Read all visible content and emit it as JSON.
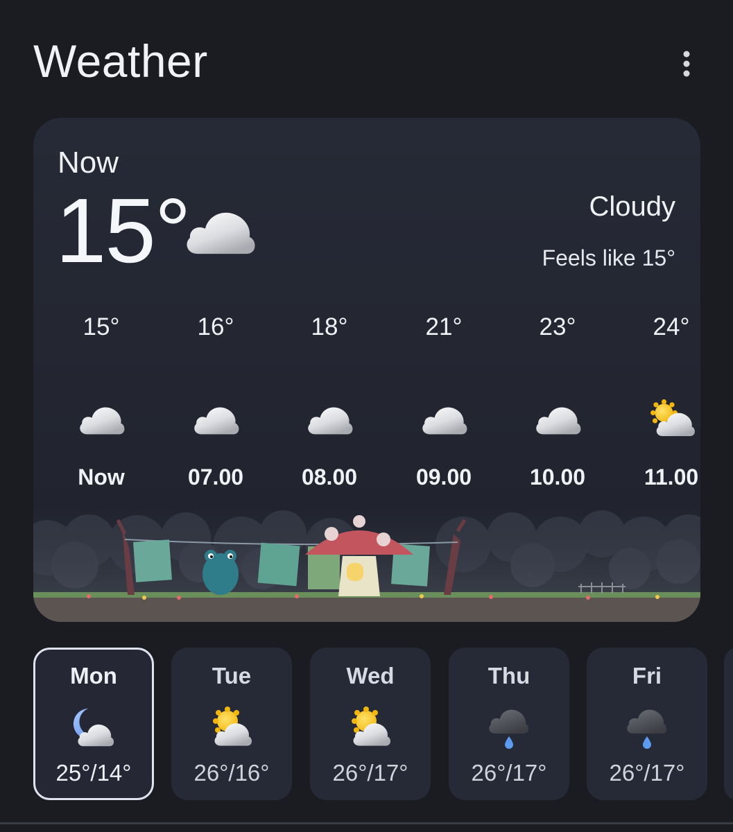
{
  "header": {
    "title": "Weather",
    "menu_icon": "more-vertical-icon"
  },
  "current": {
    "label": "Now",
    "temperature": "15°",
    "condition": "Cloudy",
    "feels_like": "Feels like 15°",
    "icon": "cloud-icon"
  },
  "hourly": [
    {
      "temp": "15°",
      "time": "Now",
      "icon": "cloud-icon"
    },
    {
      "temp": "16°",
      "time": "07.00",
      "icon": "cloud-icon"
    },
    {
      "temp": "18°",
      "time": "08.00",
      "icon": "cloud-icon"
    },
    {
      "temp": "21°",
      "time": "09.00",
      "icon": "cloud-icon"
    },
    {
      "temp": "23°",
      "time": "10.00",
      "icon": "cloud-icon"
    },
    {
      "temp": "24°",
      "time": "11.00",
      "icon": "partly-sunny-icon"
    }
  ],
  "daily": [
    {
      "day": "Mon",
      "range": "25°/14°",
      "icon": "partly-cloudy-night-icon",
      "selected": true
    },
    {
      "day": "Tue",
      "range": "26°/16°",
      "icon": "partly-sunny-icon",
      "selected": false
    },
    {
      "day": "Wed",
      "range": "26°/17°",
      "icon": "partly-sunny-icon",
      "selected": false
    },
    {
      "day": "Thu",
      "range": "26°/17°",
      "icon": "rain-cloud-icon",
      "selected": false
    },
    {
      "day": "Fri",
      "range": "26°/17°",
      "icon": "rain-cloud-icon",
      "selected": false
    }
  ],
  "colors": {
    "background": "#1b1c21",
    "card": "#262a36",
    "text": "#f1f2f6",
    "selected_border": "#dfe3ee",
    "sun": "#f6c21c",
    "rain": "#5b9cf0"
  }
}
